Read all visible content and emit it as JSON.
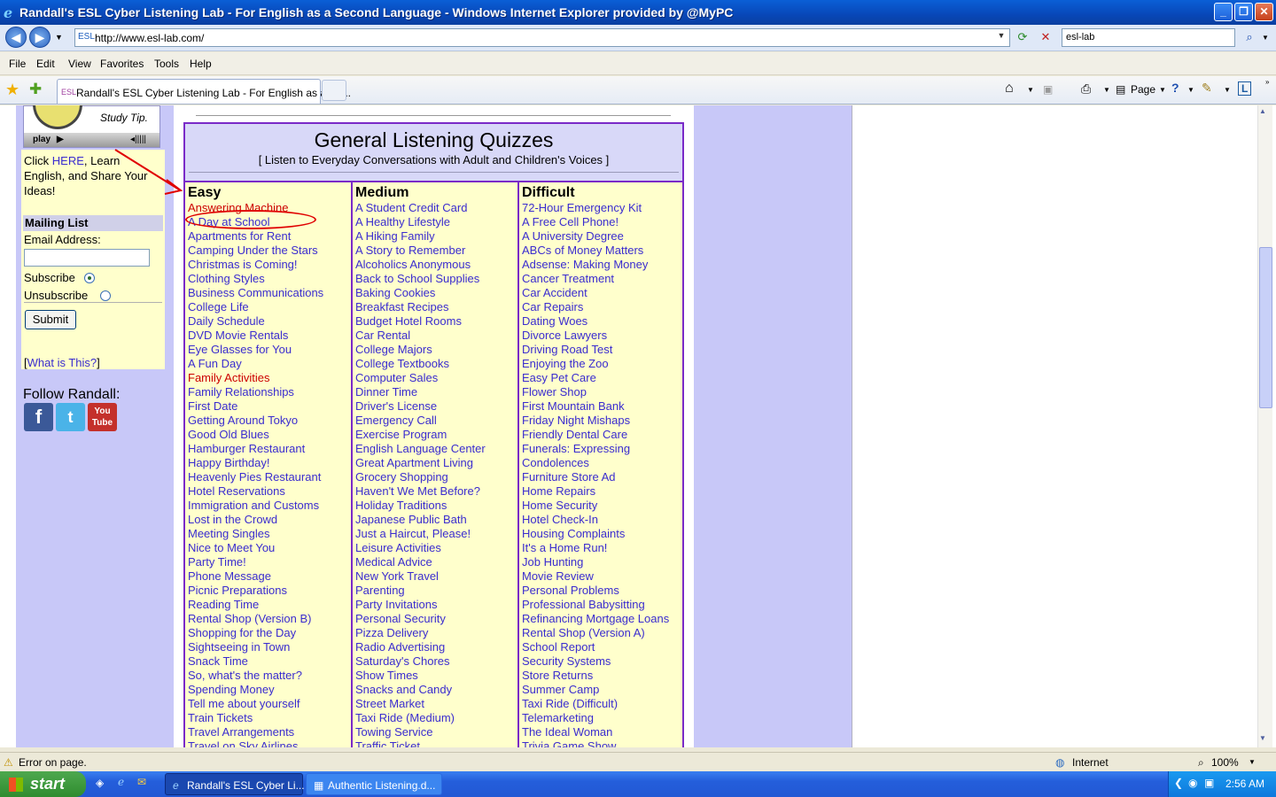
{
  "window": {
    "title": "Randall's ESL Cyber Listening Lab - For English as a Second Language - Windows Internet Explorer provided by @MyPC"
  },
  "address": {
    "esl_label": "ESL",
    "url": "http://www.esl-lab.com/",
    "search_value": "esl-lab"
  },
  "menu": [
    "File",
    "Edit",
    "View",
    "Favorites",
    "Tools",
    "Help"
  ],
  "tab": {
    "esl_label": "ESL",
    "title": "Randall's ESL Cyber Listening Lab - For English as a Se..."
  },
  "toolbar": {
    "page_label": "Page"
  },
  "sidebar": {
    "study_tip": "Study Tip.",
    "play_label": "play",
    "click_text_1": "Click ",
    "here_link": "HERE",
    "click_text_2": ", Learn English, and Share Your Ideas!",
    "mailing_header": "Mailing List",
    "email_label": "Email Address:",
    "subscribe_label": "Subscribe",
    "unsubscribe_label": "Unsubscribe",
    "submit_label": "Submit",
    "what_is_this": "What is This?",
    "follow_label": "Follow Randall:",
    "social": [
      "f",
      "t",
      "You Tube"
    ]
  },
  "quizzes": {
    "title": "General Listening Quizzes",
    "subtitle": "[ Listen to Everyday Conversations with Adult and Children's Voices ]",
    "columns": [
      {
        "heading": "Easy",
        "items": [
          "Answering Machine",
          "A Day at School",
          "Apartments for Rent",
          "Camping Under the Stars",
          "Christmas is Coming!",
          "Clothing Styles",
          "Business Communications",
          "College Life",
          "Daily Schedule",
          "DVD Movie Rentals",
          "Eye Glasses for You",
          "A Fun Day",
          "Family Activities",
          "Family Relationships",
          "First Date",
          "Getting Around Tokyo",
          "Good Old Blues",
          "Hamburger Restaurant",
          "Happy Birthday!",
          "Heavenly Pies Restaurant",
          "Hotel Reservations",
          "Immigration and Customs",
          "Lost in the Crowd",
          "Meeting Singles",
          "Nice to Meet You",
          "Party Time!",
          "Phone Message",
          "Picnic Preparations",
          "Reading Time",
          "Rental Shop (Version B)",
          "Shopping for the Day",
          "Sightseeing in Town",
          "Snack Time",
          "So, what's the matter?",
          "Spending Money",
          "Tell me about yourself",
          "Train Tickets",
          "Travel Arrangements",
          "Travel on Sky Airlines"
        ]
      },
      {
        "heading": "Medium",
        "items": [
          "A Student Credit Card",
          "A Healthy Lifestyle",
          "A Hiking Family",
          "A Story to Remember",
          "Alcoholics Anonymous",
          "Back to School Supplies",
          "Baking Cookies",
          "Breakfast Recipes",
          "Budget Hotel Rooms",
          "Car Rental",
          "College Majors",
          "College Textbooks",
          "Computer Sales",
          "Dinner Time",
          "Driver's License",
          "Emergency Call",
          "Exercise Program",
          "English Language Center",
          "Great Apartment Living",
          "Grocery Shopping",
          "Haven't We Met Before?",
          "Holiday Traditions",
          "Japanese Public Bath",
          "Just a Haircut, Please!",
          "Leisure Activities",
          "Medical Advice",
          "New York Travel",
          "Parenting",
          "Party Invitations",
          "Personal Security",
          "Pizza Delivery",
          "Radio Advertising",
          "Saturday's Chores",
          "Show Times",
          "Snacks and Candy",
          "Street Market",
          "Taxi Ride (Medium)",
          "Towing Service",
          "Traffic Ticket"
        ]
      },
      {
        "heading": "Difficult",
        "items": [
          "72-Hour Emergency Kit",
          "A Free Cell Phone!",
          "A University Degree",
          "ABCs of Money Matters",
          "Adsense: Making Money",
          "Cancer Treatment",
          "Car Accident",
          "Car Repairs",
          "Dating Woes",
          "Divorce Lawyers",
          "Driving Road Test",
          "Enjoying the Zoo",
          "Easy Pet Care",
          "Flower Shop",
          "First Mountain Bank",
          "Friday Night Mishaps",
          "Friendly Dental Care",
          "Funerals: Expressing",
          "Condolences",
          "Furniture Store Ad",
          "Home Repairs",
          "Home Security",
          "Hotel Check-In",
          "Housing Complaints",
          "It's a Home Run!",
          "Job Hunting",
          "Movie Review",
          "Personal Problems",
          "Professional Babysitting",
          "Refinancing Mortgage Loans",
          "Rental Shop (Version A)",
          "School Report",
          "Security Systems",
          "Store Returns",
          "Summer Camp",
          "Taxi Ride (Difficult)",
          "Telemarketing",
          "The Ideal Woman",
          "Trivia Game Show"
        ]
      }
    ]
  },
  "status": {
    "message": "Error on page.",
    "zone": "Internet",
    "zoom": "100%"
  },
  "taskbar": {
    "start_label": "start",
    "tasks": [
      "Randall's ESL Cyber Li...",
      "Authentic Listening.d..."
    ],
    "clock": "2:56 AM"
  },
  "colors": {
    "link": "#3a2ccf",
    "visited_red": "#cc0000",
    "quiz_border": "#7a2ac8",
    "sidebar_bg": "#c8c8f8",
    "quiz_bg": "#ffffcc"
  }
}
